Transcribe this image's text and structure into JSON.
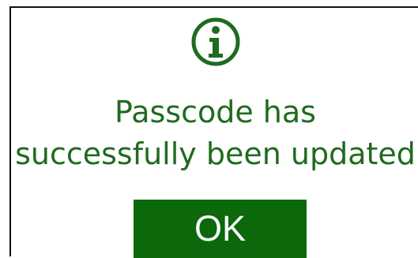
{
  "dialog": {
    "icon": "info-icon",
    "message_lines": [
      "Passcode has",
      "successfully been updated"
    ],
    "ok_label": "OK"
  },
  "colors": {
    "text": "#1f6b1f",
    "button": "#0b680b",
    "button_text": "#ffffff",
    "border": "#111111"
  }
}
